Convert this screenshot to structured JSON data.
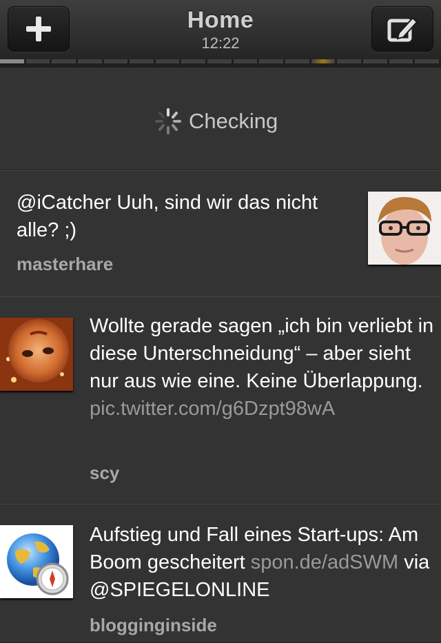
{
  "header": {
    "title": "Home",
    "time": "12:22",
    "left_icon": "plus-icon",
    "right_icon": "compose-icon"
  },
  "status": {
    "label": "Checking",
    "icon": "spinner-icon"
  },
  "tweets": [
    {
      "text": "@iCatcher Uuh, sind wir das nicht alle? ;)",
      "user": "masterhare"
    },
    {
      "text": "Wollte gerade sagen „ich bin verliebt in diese Unterschneidung“ – aber sieht nur aus wie eine. Keine Überlappung.",
      "link": "pic.twitter.com/g6Dzpt98wA",
      "user": "scy"
    },
    {
      "text": "Aufstieg und Fall eines Start-ups: Am Boom gescheitert",
      "link": "spon.de/adSWM",
      "suffix": "via @SPIEGELONLINE",
      "user": "blogginginside"
    }
  ]
}
